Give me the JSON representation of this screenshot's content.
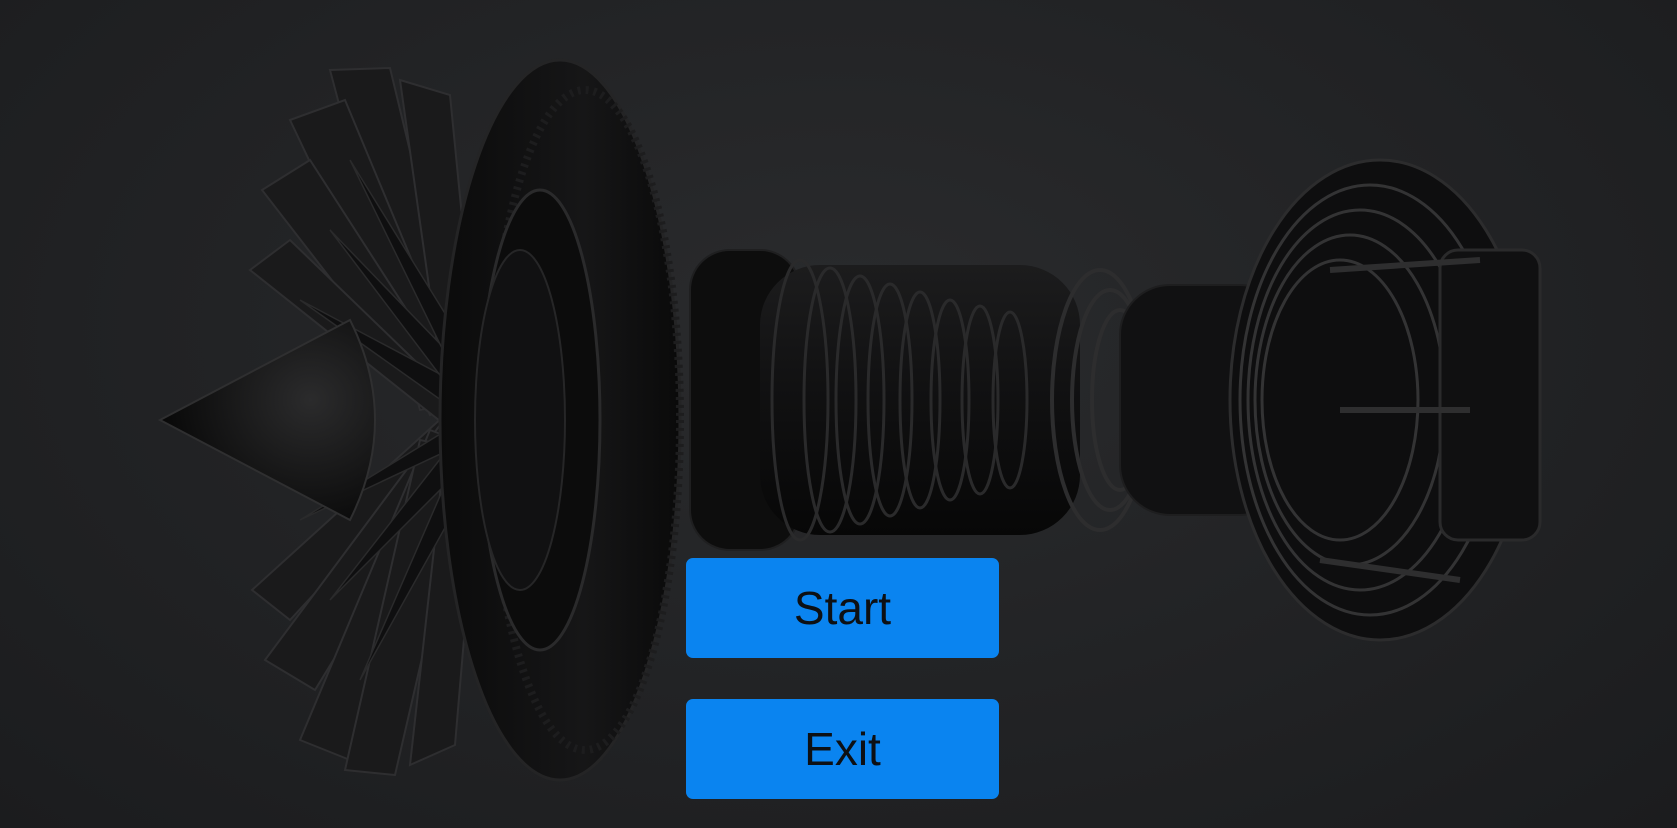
{
  "scene": {
    "background_image": "jet-engine-turbofan-render",
    "background_color": "#1f2022"
  },
  "menu": {
    "start_label": "Start",
    "exit_label": "Exit",
    "button_color": "#0a84f0",
    "button_text_color": "#0d1014"
  }
}
